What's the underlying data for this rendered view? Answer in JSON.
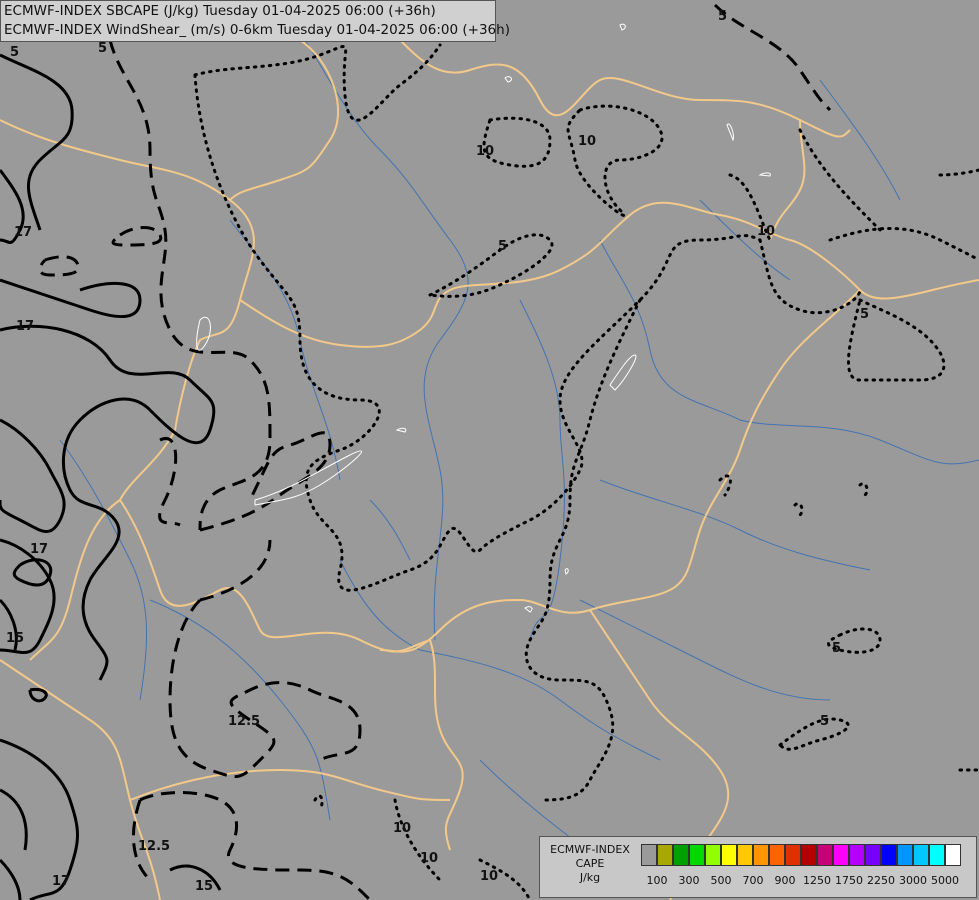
{
  "header": {
    "line1": "ECMWF-INDEX SBCAPE (J/kg) Tuesday 01-04-2025 06:00 (+36h)",
    "line2": "ECMWF-INDEX WindShear_ (m/s) 0-6km Tuesday 01-04-2025 06:00 (+36h)"
  },
  "colors": {
    "background": "#9a9a9a",
    "border_lines": "#f2c98a",
    "rivers": "#3a6fb5",
    "cape_contours": "#000000",
    "shear_contours": "#000000"
  },
  "contour_labels": {
    "cape": [
      "5",
      "10",
      "10",
      "10",
      "5",
      "5",
      "5",
      "5",
      "10",
      "10",
      "10",
      "5"
    ],
    "shear": [
      "17",
      "17",
      "17",
      "15",
      "12.5",
      "12.5",
      "15",
      "17",
      "5"
    ]
  },
  "legend": {
    "title_lines": [
      "ECMWF-INDEX",
      "CAPE",
      "J/kg"
    ],
    "swatch_colors": [
      "#9a9a9a",
      "#a8a800",
      "#00a000",
      "#00d800",
      "#90ff00",
      "#ffff00",
      "#ffc800",
      "#ff9600",
      "#ff6400",
      "#e03000",
      "#b40000",
      "#c80078",
      "#ff00ff",
      "#b400ff",
      "#7800ff",
      "#0000ff",
      "#0096ff",
      "#00c8ff",
      "#00ffff",
      "#ffffff"
    ],
    "tick_labels": [
      "100",
      "300",
      "500",
      "700",
      "900",
      "1250",
      "1750",
      "2250",
      "3000",
      "5000"
    ]
  }
}
